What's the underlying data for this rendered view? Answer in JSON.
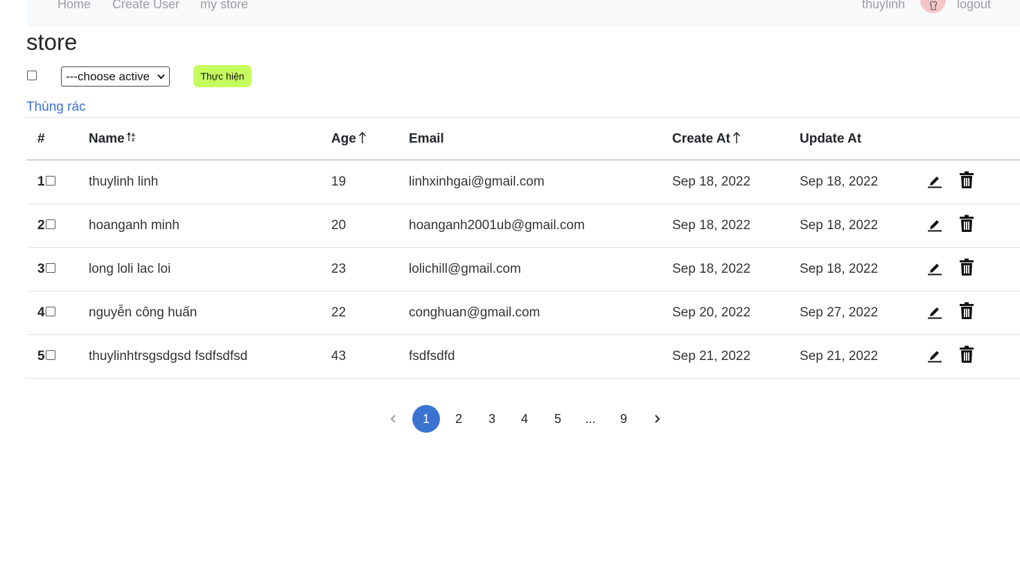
{
  "nav": {
    "links": [
      "Home",
      "Create User",
      "my store"
    ],
    "username": "thuylinh",
    "logout": "logout"
  },
  "page": {
    "title": "store",
    "select_value": "---choose active",
    "run_label": "Thực hiện",
    "trash_link": "Thùng rác"
  },
  "table": {
    "headers": [
      "#",
      "Name",
      "Age",
      "Email",
      "Create At",
      "Update At"
    ],
    "rows": [
      {
        "idx": "1",
        "name": "thuylinh linh",
        "age": "19",
        "email": "linhxinhgai@gmail.com",
        "created": "Sep 18, 2022",
        "updated": "Sep 18, 2022"
      },
      {
        "idx": "2",
        "name": "hoanganh minh",
        "age": "20",
        "email": "hoanganh2001ub@gmail.com",
        "created": "Sep 18, 2022",
        "updated": "Sep 18, 2022"
      },
      {
        "idx": "3",
        "name": "long loli lac loi",
        "age": "23",
        "email": "lolichill@gmail.com",
        "created": "Sep 18, 2022",
        "updated": "Sep 18, 2022"
      },
      {
        "idx": "4",
        "name": "nguyễn công huấn",
        "age": "22",
        "email": "conghuan@gmail.com",
        "created": "Sep 20, 2022",
        "updated": "Sep 27, 2022"
      },
      {
        "idx": "5",
        "name": "thuylinhtrsgsdgsd fsdfsdfsd",
        "age": "43",
        "email": "fsdfsdfd",
        "created": "Sep 21, 2022",
        "updated": "Sep 21, 2022"
      }
    ]
  },
  "pagination": {
    "pages": [
      "1",
      "2",
      "3",
      "4",
      "5",
      "...",
      "9"
    ],
    "active": "1"
  },
  "colors": {
    "accent": "#3b73d0",
    "run_button": "#c6fb5e",
    "link": "#3b6fd9",
    "navbar_bg": "#f8f9fa"
  }
}
